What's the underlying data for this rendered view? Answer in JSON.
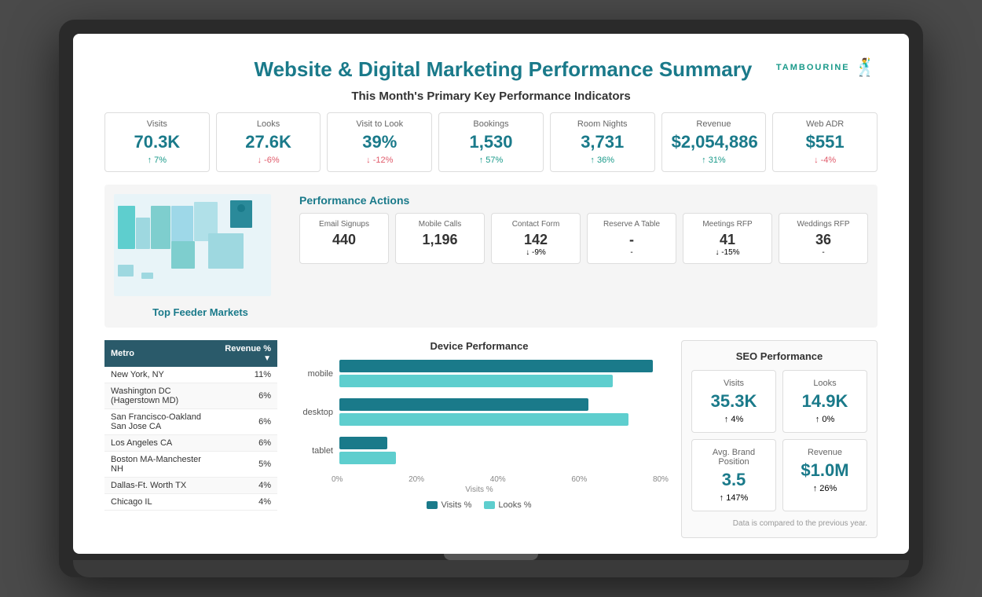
{
  "logo": {
    "text": "TAMBOURINE",
    "icon": "🕺"
  },
  "page_title": "Website & Digital Marketing Performance Summary",
  "kpi_section_title": "This Month's Primary Key Performance Indicators",
  "kpis": [
    {
      "label": "Visits",
      "value": "70.3K",
      "change": "7%",
      "direction": "up"
    },
    {
      "label": "Looks",
      "value": "27.6K",
      "change": "-6%",
      "direction": "down"
    },
    {
      "label": "Visit to Look",
      "value": "39%",
      "change": "-12%",
      "direction": "down"
    },
    {
      "label": "Bookings",
      "value": "1,530",
      "change": "57%",
      "direction": "up"
    },
    {
      "label": "Room Nights",
      "value": "3,731",
      "change": "36%",
      "direction": "up"
    },
    {
      "label": "Revenue",
      "value": "$2,054,886",
      "change": "31%",
      "direction": "up"
    },
    {
      "label": "Web ADR",
      "value": "$551",
      "change": "-4%",
      "direction": "down"
    }
  ],
  "performance_actions_title": "Performance Actions",
  "actions": [
    {
      "label": "Email Signups",
      "value": "440",
      "change": "",
      "direction": "neutral"
    },
    {
      "label": "Mobile Calls",
      "value": "1,196",
      "change": "",
      "direction": "neutral"
    },
    {
      "label": "Contact Form",
      "value": "142",
      "change": "-9%",
      "direction": "down"
    },
    {
      "label": "Reserve A Table",
      "value": "-",
      "change": "-",
      "direction": "neutral"
    },
    {
      "label": "Meetings RFP",
      "value": "41",
      "change": "-15%",
      "direction": "down"
    },
    {
      "label": "Weddings RFP",
      "value": "36",
      "change": "-",
      "direction": "neutral"
    }
  ],
  "feeder_markets_title": "Top Feeder Markets",
  "feeder_col1": "Metro",
  "feeder_col2": "Revenue %",
  "feeder_markets": [
    {
      "metro": "New York, NY",
      "revenue": "11%"
    },
    {
      "metro": "Washington DC (Hagerstown MD)",
      "revenue": "6%"
    },
    {
      "metro": "San Francisco-Oakland San Jose CA",
      "revenue": "6%"
    },
    {
      "metro": "Los Angeles CA",
      "revenue": "6%"
    },
    {
      "metro": "Boston MA-Manchester NH",
      "revenue": "5%"
    },
    {
      "metro": "Dallas-Ft. Worth TX",
      "revenue": "4%"
    },
    {
      "metro": "Chicago IL",
      "revenue": "4%"
    }
  ],
  "device_performance_title": "Device Performance",
  "devices": [
    {
      "label": "mobile",
      "visits_pct": 78,
      "looks_pct": 68
    },
    {
      "label": "desktop",
      "visits_pct": 62,
      "looks_pct": 72
    },
    {
      "label": "tablet",
      "visits_pct": 12,
      "looks_pct": 14
    }
  ],
  "chart_x_labels": [
    "0%",
    "20%",
    "40%",
    "60%",
    "80%"
  ],
  "chart_x_axis_label": "Visits %",
  "legend_visits": "Visits %",
  "legend_looks": "Looks %",
  "seo_title": "SEO Performance",
  "seo_cards": [
    {
      "label": "Visits",
      "value": "35.3K",
      "change": "4%",
      "direction": "up"
    },
    {
      "label": "Looks",
      "value": "14.9K",
      "change": "0%",
      "direction": "up"
    },
    {
      "label": "Avg. Brand Position",
      "value": "3.5",
      "change": "147%",
      "direction": "up"
    },
    {
      "label": "Revenue",
      "value": "$1.0M",
      "change": "26%",
      "direction": "up"
    }
  ],
  "footer_note": "Data is compared to the previous year."
}
